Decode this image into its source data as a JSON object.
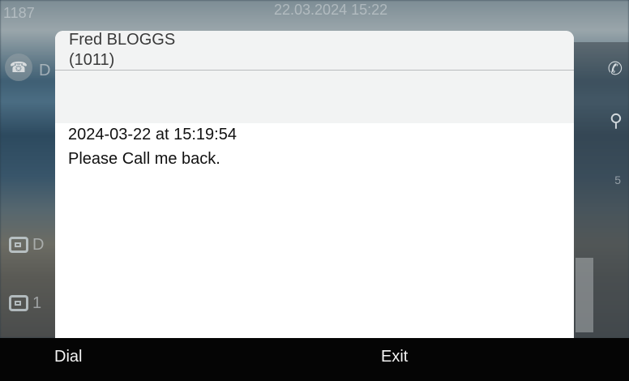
{
  "background": {
    "status_left": "1187",
    "status_center": "22.03.2024 15:22",
    "phone_line_label": "D",
    "lines": [
      {
        "label": "D"
      },
      {
        "label": "1"
      }
    ],
    "right_counter": "5"
  },
  "dialog": {
    "contact_name": "Fred BLOGGS",
    "contact_number": "(1011)",
    "timestamp": "2024-03-22 at 15:19:54",
    "message": "Please Call me back."
  },
  "softkeys": {
    "dial_label": "Dial",
    "exit_label": "Exit"
  },
  "colors": {
    "dialog_header": "#f2f3f3",
    "softkey_bar": "#050505",
    "softkey_text": "#f4f4f4"
  },
  "icons": {
    "phone": "phone-icon",
    "line": "line-key-icon",
    "handset": "handset-icon",
    "person": "person-icon"
  }
}
